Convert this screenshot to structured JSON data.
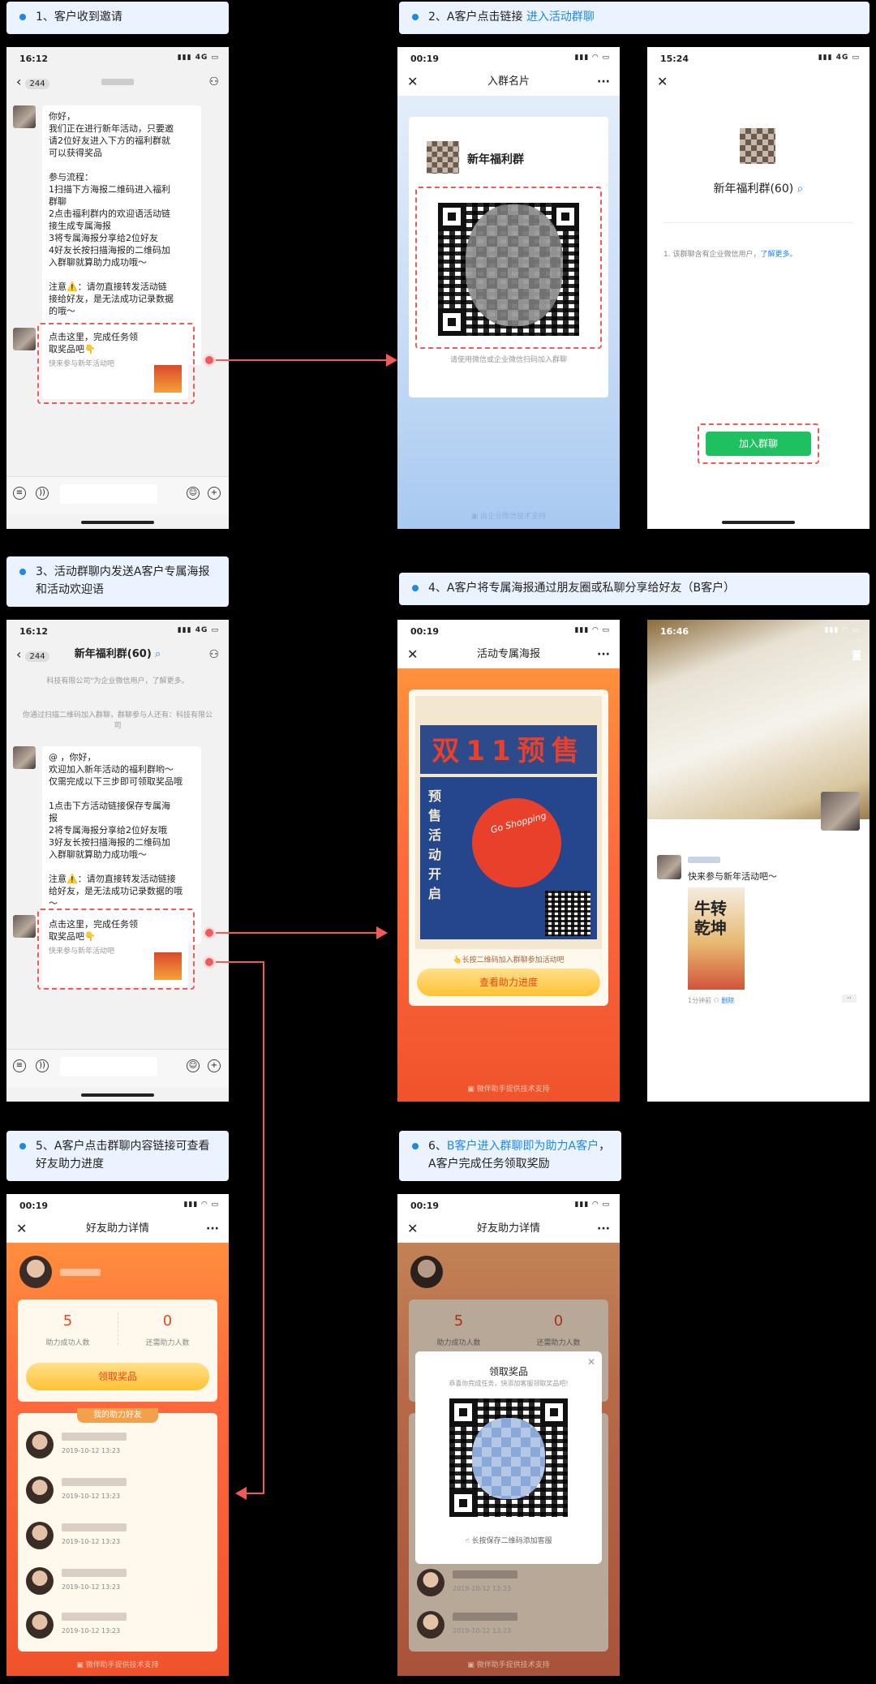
{
  "steps": {
    "s1": "1、客户收到邀请",
    "s2_a": "2、A客户点击链接 ",
    "s2_b": "进入活动群聊",
    "s3": "3、活动群聊内发送A客户专属海报和活动欢迎语",
    "s4": "4、A客户将专属海报通过朋友圈或私聊分享给好友（B客户）",
    "s5": "5、A客户点击群聊内容链接可查看好友助力进度",
    "s6_a": "6、",
    "s6_b": "B客户进入群聊即为助力A客户",
    "s6_c": "，A客户完成任务领取奖励"
  },
  "phone1": {
    "time": "16:12",
    "signal": "4G",
    "back_count": "244",
    "msg_lines": [
      "你好，",
      "我们正在进行新年活动，只要邀",
      "请2位好友进入下方的福利群就",
      "可以获得奖品",
      "",
      "参与流程：",
      "1扫描下方海报二维码进入福利",
      "群聊",
      "2点击福利群内的欢迎语活动链",
      "接生成专属海报",
      "3将专属海报分享给2位好友",
      "4好友长按扫描海报的二维码加",
      "入群聊就算助力成功哦～",
      "",
      "注意⚠️：请勿直接转发活动链",
      "接给好友，是无法成功记录数据",
      "的哦～"
    ],
    "link_title": "点击这里，完成任务领取奖品吧👇",
    "link_desc": "快来参与新年活动吧"
  },
  "phone2": {
    "time": "00:19",
    "title": "入群名片",
    "group_name": "新年福利群",
    "hint": "请使用微信或企业微信扫码加入群聊",
    "footer": "由企业微信技术支持"
  },
  "phone3": {
    "time": "15:24",
    "signal": "4G",
    "group_name": "新年福利群(60)",
    "notice": "1. 该群聊含有企业微信用户，",
    "notice_link": "了解更多。",
    "join_btn": "加入群聊"
  },
  "phone4": {
    "time": "16:12",
    "signal": "4G",
    "back_count": "244",
    "title": "新年福利群(60)",
    "sys1": "科技有限公司\"为企业微信用户，了解更多。",
    "sys2": "你通过扫描二维码加入群聊，群聊参与人还有：科技有限公司",
    "msg_lines": [
      "@        ，你好，",
      "欢迎加入新年活动的福利群哟～",
      "仅需完成以下三步即可领取奖品哦",
      "",
      "1点击下方活动链接保存专属海",
      "报",
      "2将专属海报分享给2位好友哦",
      "3好友长按扫描海报的二维码加",
      "入群聊就算助力成功哦～",
      "",
      "注意⚠️：请勿直接转发活动链接",
      "给好友，是无法成功记录数据的哦",
      "～"
    ],
    "link_title": "点击这里，完成任务领取奖品吧👇",
    "link_desc": "快来参与新年活动吧"
  },
  "phone5": {
    "time": "00:19",
    "title": "活动专属海报",
    "poster_title": "双11预售",
    "poster_side": "预售活动开启",
    "shopping": "Go Shopping",
    "hint": "👆长按二维码加入群聊参加活动吧",
    "btn": "查看助力进度",
    "footer": "微伴助手提供技术支持"
  },
  "phone6": {
    "time": "16:46",
    "post_text": "快来参与新年活动吧～",
    "poster_caption": "牛转乾坤",
    "post_time": "1分钟前",
    "delete": "删除"
  },
  "phone7": {
    "time": "00:19",
    "title": "好友助力详情",
    "stat1_num": "5",
    "stat1_label": "助力成功人数",
    "stat2_num": "0",
    "stat2_label": "还需助力人数",
    "btn": "领取奖品",
    "section": "我的助力好友",
    "times": [
      "2019-10-12 13:23",
      "2019-10-12 13:23",
      "2019-10-12 13:23",
      "2019-10-12 13:23",
      "2019-10-12 13:23"
    ],
    "footer": "微伴助手提供技术支持"
  },
  "phone8": {
    "time": "00:19",
    "title": "好友助力详情",
    "stat1_num": "5",
    "stat1_label": "助力成功人数",
    "stat2_num": "0",
    "stat2_label": "还需助力人数",
    "modal_title": "领取奖品",
    "modal_sub": "恭喜你完成任务，快添加客服领取奖品吧!",
    "modal_hint": "长按保存二维码添加客服",
    "times": [
      "2019-10-12 13:23",
      "2019-10-12 13:23"
    ],
    "footer": "微伴助手提供技术支持"
  },
  "colors": {
    "accent": "#1e88e5",
    "red": "#f05a5a",
    "orange": "#ff6a3d",
    "green": "#1ec060"
  }
}
